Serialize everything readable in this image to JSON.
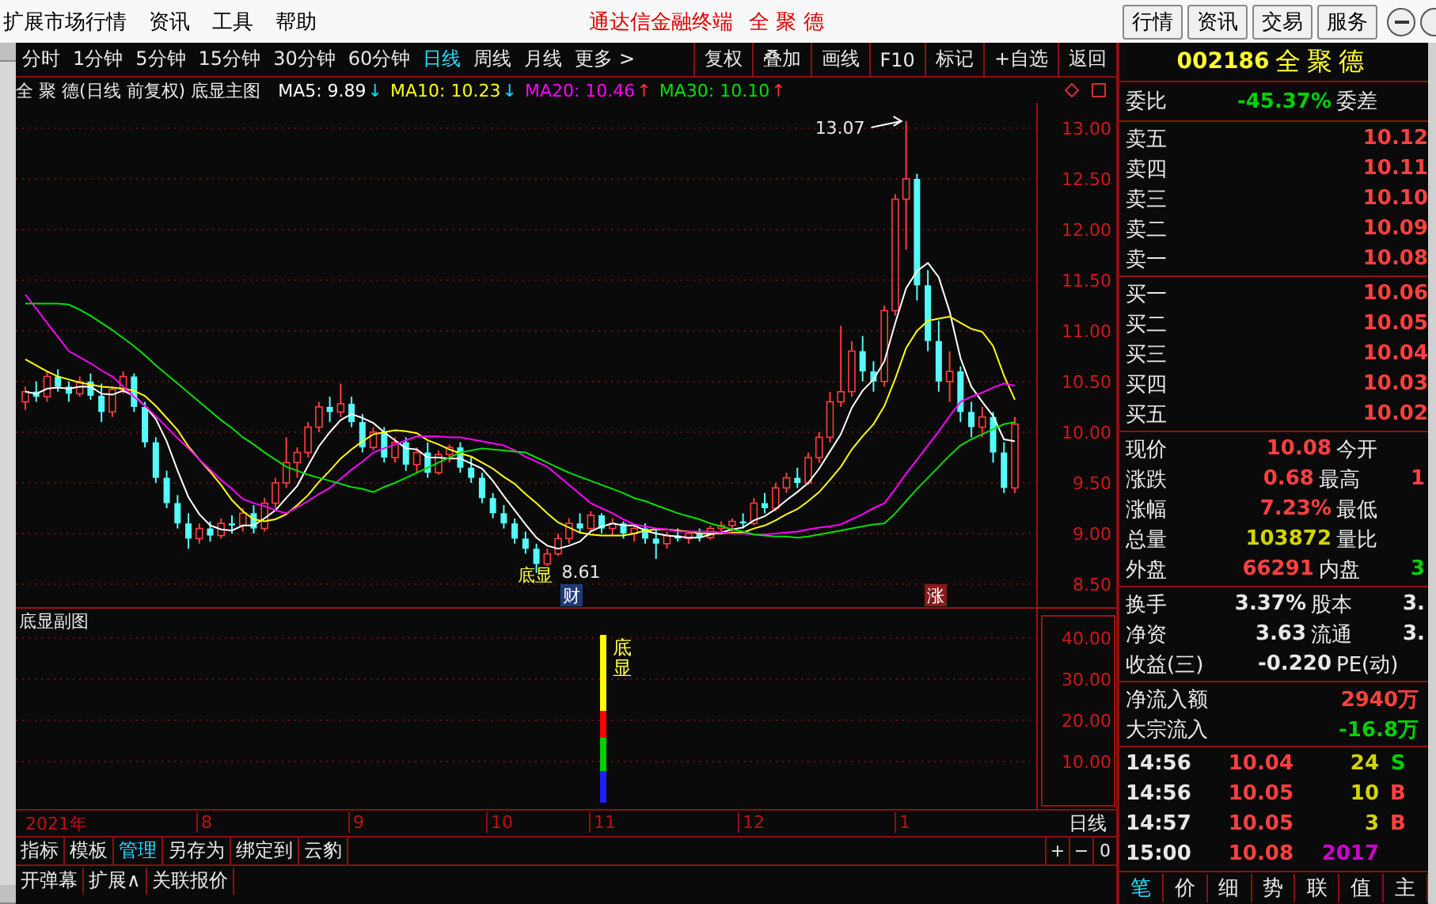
{
  "menubar": {
    "items": [
      "扩展市场行情",
      "资讯",
      "工具",
      "帮助"
    ],
    "title": "通达信金融终端",
    "stock": "全 聚 德",
    "buttons": [
      "行情",
      "资讯",
      "交易",
      "服务"
    ]
  },
  "toolbar": {
    "periods": [
      {
        "label": "分时",
        "selected": false
      },
      {
        "label": "1分钟",
        "selected": false
      },
      {
        "label": "5分钟",
        "selected": false
      },
      {
        "label": "15分钟",
        "selected": false
      },
      {
        "label": "30分钟",
        "selected": false
      },
      {
        "label": "60分钟",
        "selected": false
      },
      {
        "label": "日线",
        "selected": true
      },
      {
        "label": "周线",
        "selected": false
      },
      {
        "label": "月线",
        "selected": false
      },
      {
        "label": "更多 >",
        "selected": false
      }
    ],
    "tools": [
      "复权",
      "叠加",
      "画线",
      "F10",
      "标记",
      "+自选",
      "返回"
    ]
  },
  "main_chart": {
    "title": "全 聚 德(日线 前复权) 底显主图",
    "chart_data": {
      "type": "candlestick",
      "grid": true,
      "ylim": [
        8.5,
        13
      ],
      "yticks": [
        {
          "value": 13,
          "label": "13.00"
        },
        {
          "value": 12.5,
          "label": "12.50"
        },
        {
          "value": 12,
          "label": "12.00"
        },
        {
          "value": 11.5,
          "label": "11.50"
        },
        {
          "value": 11,
          "label": "11.00"
        },
        {
          "value": 10.5,
          "label": "10.50"
        },
        {
          "value": 10,
          "label": "10.00"
        },
        {
          "value": 9.5,
          "label": "9.50"
        },
        {
          "value": 9,
          "label": "9.00"
        },
        {
          "value": 8.5,
          "label": "8.50"
        }
      ],
      "ohlc": [
        [
          10.3,
          10.45,
          10.22,
          10.4
        ],
        [
          10.4,
          10.5,
          10.3,
          10.35
        ],
        [
          10.35,
          10.6,
          10.3,
          10.55
        ],
        [
          10.55,
          10.62,
          10.4,
          10.45
        ],
        [
          10.45,
          10.5,
          10.3,
          10.38
        ],
        [
          10.38,
          10.55,
          10.35,
          10.5
        ],
        [
          10.5,
          10.58,
          10.32,
          10.36
        ],
        [
          10.36,
          10.48,
          10.1,
          10.2
        ],
        [
          10.2,
          10.45,
          10.15,
          10.42
        ],
        [
          10.42,
          10.6,
          10.38,
          10.55
        ],
        [
          10.55,
          10.58,
          10.2,
          10.25
        ],
        [
          10.25,
          10.3,
          9.85,
          9.9
        ],
        [
          9.9,
          9.95,
          9.5,
          9.55
        ],
        [
          9.55,
          9.62,
          9.25,
          9.3
        ],
        [
          9.3,
          9.38,
          9.05,
          9.1
        ],
        [
          9.1,
          9.2,
          8.85,
          8.95
        ],
        [
          8.95,
          9.1,
          8.9,
          9.05
        ],
        [
          9.05,
          9.12,
          8.92,
          8.98
        ],
        [
          8.98,
          9.15,
          8.95,
          9.1
        ],
        [
          9.1,
          9.18,
          9.0,
          9.08
        ],
        [
          9.08,
          9.25,
          9.02,
          9.2
        ],
        [
          9.2,
          9.28,
          9.0,
          9.05
        ],
        [
          9.05,
          9.35,
          9.02,
          9.3
        ],
        [
          9.3,
          9.55,
          9.25,
          9.5
        ],
        [
          9.5,
          9.95,
          9.45,
          9.7
        ],
        [
          9.7,
          9.85,
          9.55,
          9.8
        ],
        [
          9.8,
          10.1,
          9.75,
          10.05
        ],
        [
          10.05,
          10.3,
          10.0,
          10.25
        ],
        [
          10.25,
          10.35,
          10.1,
          10.2
        ],
        [
          10.2,
          10.48,
          10.15,
          10.28
        ],
        [
          10.28,
          10.35,
          10.05,
          10.1
        ],
        [
          10.1,
          10.18,
          9.8,
          9.85
        ],
        [
          9.85,
          10.05,
          9.82,
          10.0
        ],
        [
          10.0,
          10.05,
          9.7,
          9.75
        ],
        [
          9.75,
          9.95,
          9.7,
          9.9
        ],
        [
          9.9,
          9.95,
          9.62,
          9.68
        ],
        [
          9.68,
          9.85,
          9.6,
          9.8
        ],
        [
          9.8,
          9.9,
          9.55,
          9.6
        ],
        [
          9.6,
          9.82,
          9.58,
          9.78
        ],
        [
          9.78,
          9.88,
          9.7,
          9.85
        ],
        [
          9.85,
          9.9,
          9.6,
          9.65
        ],
        [
          9.65,
          9.75,
          9.5,
          9.55
        ],
        [
          9.55,
          9.6,
          9.3,
          9.35
        ],
        [
          9.35,
          9.4,
          9.15,
          9.2
        ],
        [
          9.2,
          9.28,
          9.05,
          9.1
        ],
        [
          9.1,
          9.15,
          8.9,
          8.95
        ],
        [
          8.95,
          9.02,
          8.8,
          8.85
        ],
        [
          8.85,
          8.9,
          8.61,
          8.7
        ],
        [
          8.7,
          8.85,
          8.68,
          8.8
        ],
        [
          8.8,
          9.0,
          8.78,
          8.95
        ],
        [
          8.95,
          9.15,
          8.9,
          9.1
        ],
        [
          9.1,
          9.2,
          9.0,
          9.05
        ],
        [
          9.05,
          9.22,
          9.02,
          9.18
        ],
        [
          9.18,
          9.2,
          9.0,
          9.05
        ],
        [
          9.05,
          9.15,
          8.98,
          9.1
        ],
        [
          9.1,
          9.12,
          8.95,
          9.0
        ],
        [
          9.0,
          9.08,
          8.92,
          9.05
        ],
        [
          9.05,
          9.1,
          8.9,
          8.95
        ],
        [
          8.95,
          9.05,
          8.75,
          8.9
        ],
        [
          8.9,
          9.02,
          8.85,
          8.98
        ],
        [
          8.98,
          9.05,
          8.92,
          8.95
        ],
        [
          8.95,
          9.02,
          8.9,
          9.0
        ],
        [
          9.0,
          9.05,
          8.92,
          8.96
        ],
        [
          8.96,
          9.08,
          8.94,
          9.05
        ],
        [
          9.05,
          9.12,
          9.0,
          9.08
        ],
        [
          9.08,
          9.15,
          9.02,
          9.12
        ],
        [
          9.12,
          9.2,
          9.05,
          9.1
        ],
        [
          9.1,
          9.35,
          9.08,
          9.3
        ],
        [
          9.3,
          9.4,
          9.2,
          9.25
        ],
        [
          9.25,
          9.5,
          9.22,
          9.45
        ],
        [
          9.45,
          9.6,
          9.4,
          9.55
        ],
        [
          9.55,
          9.65,
          9.45,
          9.5
        ],
        [
          9.5,
          9.8,
          9.48,
          9.75
        ],
        [
          9.75,
          10.0,
          9.7,
          9.95
        ],
        [
          9.95,
          10.4,
          9.9,
          10.3
        ],
        [
          10.3,
          11.05,
          10.25,
          10.4
        ],
        [
          10.4,
          10.9,
          10.35,
          10.8
        ],
        [
          10.8,
          10.95,
          10.5,
          10.6
        ],
        [
          10.6,
          10.7,
          10.4,
          10.5
        ],
        [
          10.5,
          11.25,
          10.45,
          11.2
        ],
        [
          11.2,
          12.35,
          11.15,
          12.3
        ],
        [
          12.3,
          13.07,
          11.8,
          12.5
        ],
        [
          12.5,
          12.55,
          11.3,
          11.45
        ],
        [
          11.45,
          11.6,
          10.8,
          10.9
        ],
        [
          10.9,
          11.1,
          10.4,
          10.5
        ],
        [
          10.5,
          10.8,
          10.3,
          10.6
        ],
        [
          10.6,
          10.65,
          10.1,
          10.2
        ],
        [
          10.2,
          10.3,
          9.95,
          10.05
        ],
        [
          10.05,
          10.25,
          9.95,
          10.15
        ],
        [
          10.15,
          10.2,
          9.7,
          9.8
        ],
        [
          9.8,
          9.9,
          9.4,
          9.45
        ],
        [
          9.45,
          10.15,
          9.4,
          10.08
        ]
      ]
    },
    "overlay": {
      "chart_data": {
        "type": "line",
        "ylim": [
          8.5,
          13
        ],
        "series": [
          {
            "name": "MA5: 9.89",
            "color": "#ffffff",
            "values": [
              10.4,
              10.38,
              10.43,
              10.44,
              10.43,
              10.45,
              10.45,
              10.38,
              10.37,
              10.41,
              10.36,
              10.26,
              10.13,
              9.91,
              9.62,
              9.36,
              9.19,
              9.08,
              9.04,
              9.03,
              9.08,
              9.08,
              9.15,
              9.23,
              9.35,
              9.47,
              9.67,
              9.86,
              10.0,
              10.12,
              10.18,
              10.14,
              10.09,
              10.0,
              9.92,
              9.84,
              9.83,
              9.75,
              9.75,
              9.74,
              9.74,
              9.69,
              9.64,
              9.52,
              9.37,
              9.23,
              9.09,
              8.96,
              8.88,
              8.85,
              8.88,
              8.92,
              9.02,
              9.07,
              9.1,
              9.08,
              9.08,
              9.03,
              9.0,
              8.98,
              8.97,
              8.96,
              8.96,
              8.99,
              9.01,
              9.04,
              9.06,
              9.13,
              9.17,
              9.24,
              9.33,
              9.41,
              9.5,
              9.64,
              9.81,
              9.98,
              10.24,
              10.41,
              10.52,
              10.7,
              11.08,
              11.42,
              11.59,
              11.67,
              11.53,
              11.19,
              10.73,
              10.45,
              10.3,
              10.16,
              9.93,
              9.91
            ]
          },
          {
            "name": "MA10: 10.23",
            "color": "#ffff00",
            "values": [
              10.72,
              10.66,
              10.6,
              10.55,
              10.52,
              10.49,
              10.47,
              10.45,
              10.44,
              10.43,
              10.41,
              10.36,
              10.26,
              10.14,
              10.02,
              9.86,
              9.73,
              9.61,
              9.48,
              9.33,
              9.22,
              9.14,
              9.12,
              9.14,
              9.19,
              9.28,
              9.38,
              9.51,
              9.62,
              9.74,
              9.83,
              9.91,
              9.98,
              10.0,
              10.02,
              10.01,
              9.99,
              9.92,
              9.88,
              9.83,
              9.79,
              9.76,
              9.7,
              9.64,
              9.56,
              9.49,
              9.39,
              9.3,
              9.2,
              9.11,
              9.06,
              9.01,
              8.99,
              8.98,
              8.98,
              8.98,
              9.0,
              9.03,
              9.04,
              9.04,
              9.03,
              9.02,
              9.0,
              9.0,
              9.0,
              9.01,
              9.01,
              9.05,
              9.08,
              9.13,
              9.19,
              9.24,
              9.32,
              9.41,
              9.53,
              9.66,
              9.83,
              9.96,
              10.08,
              10.26,
              10.53,
              10.83,
              11.0,
              11.1,
              11.12,
              11.14,
              11.08,
              11.02,
              10.99,
              10.85,
              10.56,
              10.32
            ]
          },
          {
            "name": "MA20: 10.46",
            "color": "#ff00ff",
            "values": [
              11.36,
              11.22,
              11.08,
              10.94,
              10.8,
              10.74,
              10.68,
              10.61,
              10.55,
              10.45,
              10.35,
              10.26,
              10.16,
              10.05,
              9.94,
              9.84,
              9.73,
              9.63,
              9.53,
              9.44,
              9.34,
              9.3,
              9.27,
              9.23,
              9.2,
              9.26,
              9.32,
              9.39,
              9.45,
              9.54,
              9.63,
              9.71,
              9.8,
              9.84,
              9.88,
              9.92,
              9.96,
              9.96,
              9.96,
              9.95,
              9.95,
              9.93,
              9.91,
              9.89,
              9.87,
              9.82,
              9.76,
              9.71,
              9.66,
              9.57,
              9.48,
              9.39,
              9.3,
              9.25,
              9.2,
              9.14,
              9.09,
              9.07,
              9.05,
              9.04,
              9.02,
              9.02,
              9.02,
              9.02,
              9.01,
              9.0,
              9.0,
              8.99,
              8.99,
              9.0,
              9.01,
              9.02,
              9.04,
              9.06,
              9.07,
              9.09,
              9.14,
              9.19,
              9.25,
              9.3,
              9.44,
              9.59,
              9.73,
              9.87,
              10.01,
              10.16,
              10.3,
              10.35,
              10.39,
              10.44,
              10.48,
              10.46
            ]
          },
          {
            "name": "MA30: 10.10",
            "color": "#00e000",
            "values": [
              11.27,
              11.27,
              11.27,
              11.27,
              11.26,
              11.21,
              11.15,
              11.08,
              11.01,
              10.93,
              10.85,
              10.76,
              10.66,
              10.57,
              10.48,
              10.39,
              10.3,
              10.21,
              10.12,
              10.04,
              9.95,
              9.88,
              9.8,
              9.73,
              9.66,
              9.62,
              9.58,
              9.55,
              9.52,
              9.49,
              9.46,
              9.44,
              9.41,
              9.46,
              9.5,
              9.55,
              9.6,
              9.65,
              9.7,
              9.75,
              9.8,
              9.82,
              9.84,
              9.83,
              9.82,
              9.81,
              9.8,
              9.75,
              9.7,
              9.65,
              9.6,
              9.56,
              9.52,
              9.48,
              9.44,
              9.4,
              9.35,
              9.32,
              9.28,
              9.24,
              9.2,
              9.17,
              9.14,
              9.1,
              9.07,
              9.04,
              9.02,
              8.99,
              8.98,
              8.97,
              8.97,
              8.96,
              8.97,
              8.99,
              9.01,
              9.03,
              9.05,
              9.07,
              9.09,
              9.1,
              9.2,
              9.32,
              9.44,
              9.55,
              9.66,
              9.77,
              9.87,
              9.93,
              9.98,
              10.03,
              10.08,
              10.1
            ]
          }
        ]
      }
    },
    "trend_arrows": [
      {
        "text": "↓",
        "color": "#00e0ff"
      },
      {
        "text": "↓",
        "color": "#00e0ff"
      },
      {
        "text": "↑",
        "color": "#ff3030"
      },
      {
        "text": "↑",
        "color": "#ff3030"
      }
    ],
    "high_label": "13.07",
    "low_label": "8.61",
    "signal_label": "底显",
    "markers": [
      {
        "text": "财",
        "color": "#1c3c78"
      },
      {
        "text": "涨",
        "color": "#8a1a1a"
      }
    ]
  },
  "sub_chart": {
    "title": "底显副图",
    "yticks": [
      "40.00",
      "30.00",
      "20.00",
      "10.00"
    ],
    "signal_label": "底显"
  },
  "x_axis": {
    "labels": [
      "2021年",
      "8",
      "9",
      "10",
      "11",
      "12",
      "1"
    ],
    "period": "日线"
  },
  "bottom_tabs": [
    {
      "label": "指标",
      "selected": false
    },
    {
      "label": "模板",
      "selected": false
    },
    {
      "label": "管理",
      "selected": true
    },
    {
      "label": "另存为",
      "selected": false
    },
    {
      "label": "绑定到",
      "selected": false
    },
    {
      "label": "云豹",
      "selected": false
    }
  ],
  "zoom_buttons": [
    "+",
    "−",
    "0"
  ],
  "bottom_buttons": [
    "开弹幕",
    "扩展∧",
    "关联报价"
  ],
  "quote": {
    "code": "002186",
    "name": "全聚德",
    "ratio_label": "委比",
    "ratio": "-45.37%",
    "diff_label": "委差",
    "sell": [
      {
        "label": "卖五",
        "price": "10.12"
      },
      {
        "label": "卖四",
        "price": "10.11"
      },
      {
        "label": "卖三",
        "price": "10.10"
      },
      {
        "label": "卖二",
        "price": "10.09"
      },
      {
        "label": "卖一",
        "price": "10.08"
      }
    ],
    "buy": [
      {
        "label": "买一",
        "price": "10.06"
      },
      {
        "label": "买二",
        "price": "10.05"
      },
      {
        "label": "买三",
        "price": "10.04"
      },
      {
        "label": "买四",
        "price": "10.03"
      },
      {
        "label": "买五",
        "price": "10.02"
      }
    ],
    "stats": [
      {
        "label": "现价",
        "value": {
          "text": "10.08",
          "color": "#ff4040"
        },
        "label2": "今开"
      },
      {
        "label": "涨跌",
        "value": {
          "text": "0.68",
          "color": "#ff4040"
        },
        "label2": "最高",
        "value2": {
          "text": "1",
          "color": "#ff4040"
        }
      },
      {
        "label": "涨幅",
        "value": {
          "text": "7.23%",
          "color": "#ff4040"
        },
        "label2": "最低"
      },
      {
        "label": "总量",
        "value": {
          "text": "103872",
          "color": "#d4d400"
        },
        "label2": "量比"
      },
      {
        "label": "外盘",
        "value": {
          "text": "66291",
          "color": "#ff4040"
        },
        "label2": "内盘",
        "value2": {
          "text": "3",
          "color": "#00d000"
        }
      }
    ],
    "finance": [
      {
        "label": "换手",
        "value": "3.37%",
        "label2": "股本",
        "value2": "3."
      },
      {
        "label": "净资",
        "value": "3.63",
        "label2": "流通",
        "value2": "3."
      },
      {
        "label": "收益(三)",
        "value": "-0.220",
        "label2": "PE(动)"
      }
    ],
    "flows": [
      {
        "label": "净流入额",
        "value": "2940万",
        "color": "#ff4040"
      },
      {
        "label": "大宗流入",
        "value": "-16.8万",
        "color": "#00d000"
      }
    ],
    "ticks": [
      {
        "time": "14:56",
        "price": "10.04",
        "volume": {
          "text": "24",
          "color": "#d4d400"
        },
        "side": {
          "text": "S",
          "color": "#00d000"
        }
      },
      {
        "time": "14:56",
        "price": "10.05",
        "volume": {
          "text": "10",
          "color": "#d4d400"
        },
        "side": {
          "text": "B",
          "color": "#ff4040"
        }
      },
      {
        "time": "14:57",
        "price": "10.05",
        "volume": {
          "text": "3",
          "color": "#d4d400"
        },
        "side": {
          "text": "B",
          "color": "#ff4040"
        }
      },
      {
        "time": "15:00",
        "price": "10.08",
        "volume": {
          "text": "2017",
          "color": "#d000d0"
        }
      }
    ],
    "tabs": [
      {
        "label": "笔",
        "selected": true
      },
      {
        "label": "价",
        "selected": false
      },
      {
        "label": "细",
        "selected": false
      },
      {
        "label": "势",
        "selected": false
      },
      {
        "label": "联",
        "selected": false
      },
      {
        "label": "值",
        "selected": false
      },
      {
        "label": "主",
        "selected": false
      }
    ]
  }
}
